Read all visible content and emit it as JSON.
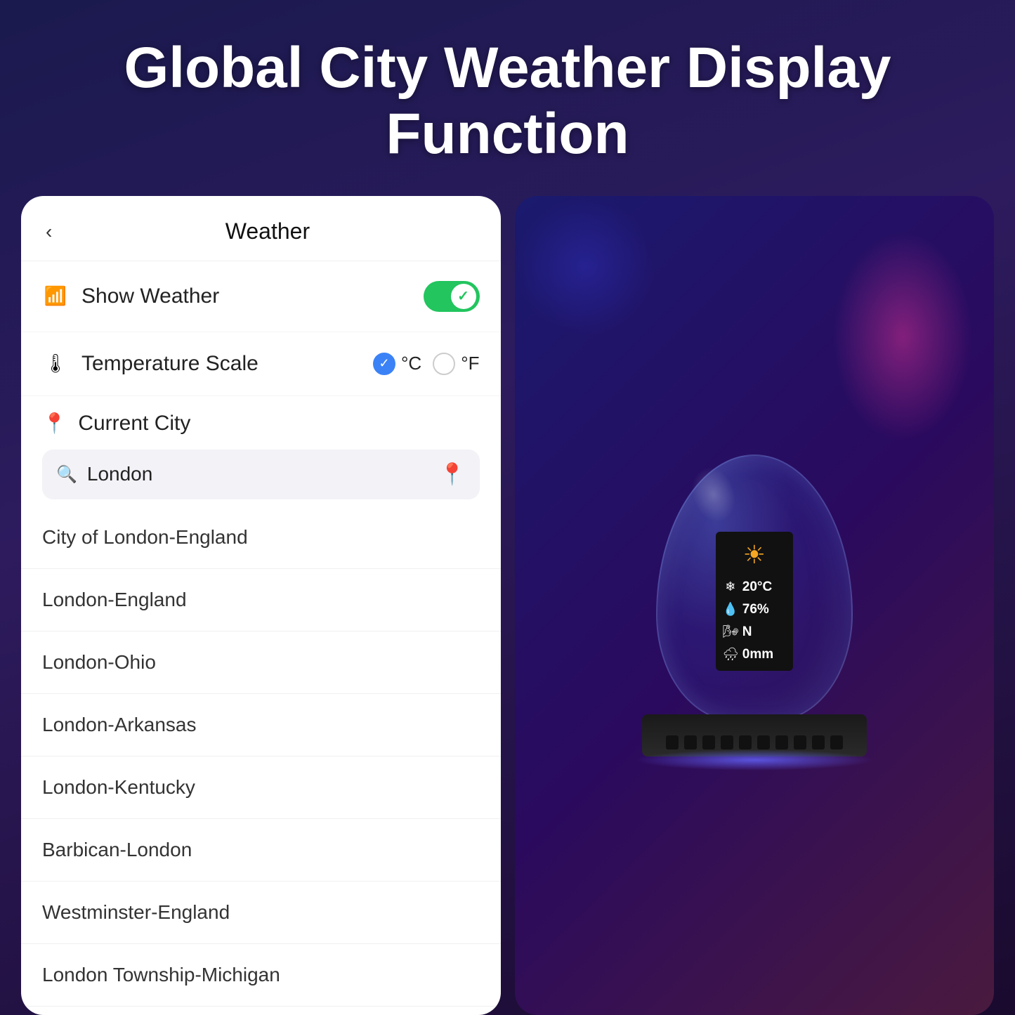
{
  "title": "Global City Weather Display Function",
  "phone": {
    "back_label": "‹",
    "header_title": "Weather",
    "show_weather_label": "Show Weather",
    "show_weather_icon": "📶",
    "toggle_on": true,
    "temp_scale_label": "Temperature Scale",
    "temp_scale_icon": "🌡",
    "celsius_label": "°C",
    "fahrenheit_label": "°F",
    "celsius_selected": true,
    "current_city_label": "Current City",
    "current_city_icon": "📍",
    "search_placeholder": "London",
    "cities": [
      "City of London-England",
      "London-England",
      "London-Ohio",
      "London-Arkansas",
      "London-Kentucky",
      "Barbican-London",
      "Westminster-England",
      "London Township-Michigan"
    ]
  },
  "device": {
    "temp": "20°C",
    "humidity": "76%",
    "wind": "N",
    "rain": "0mm"
  }
}
